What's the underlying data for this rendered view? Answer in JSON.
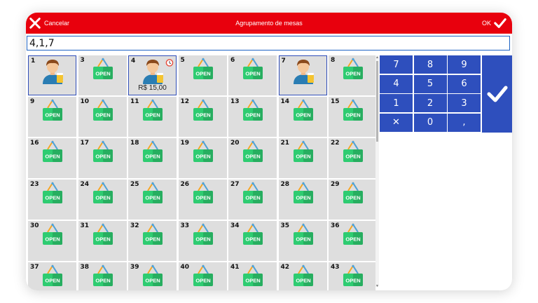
{
  "header": {
    "cancel_label": "Cancelar",
    "title": "Agrupamento de mesas",
    "ok_label": "OK",
    "bg_color": "#e8000d"
  },
  "input": {
    "value": "4,1,7"
  },
  "open_label": "OPEN",
  "tables": [
    {
      "number": "1",
      "state": "occupied",
      "selected": true
    },
    {
      "number": "3",
      "state": "open"
    },
    {
      "number": "4",
      "state": "occupied",
      "selected": true,
      "price": "R$ 15,00",
      "timer": true
    },
    {
      "number": "5",
      "state": "open"
    },
    {
      "number": "6",
      "state": "open"
    },
    {
      "number": "7",
      "state": "occupied",
      "selected": true
    },
    {
      "number": "8",
      "state": "open"
    },
    {
      "number": "9",
      "state": "open"
    },
    {
      "number": "10",
      "state": "open"
    },
    {
      "number": "11",
      "state": "open"
    },
    {
      "number": "12",
      "state": "open"
    },
    {
      "number": "13",
      "state": "open"
    },
    {
      "number": "14",
      "state": "open"
    },
    {
      "number": "15",
      "state": "open"
    },
    {
      "number": "16",
      "state": "open"
    },
    {
      "number": "17",
      "state": "open"
    },
    {
      "number": "18",
      "state": "open"
    },
    {
      "number": "19",
      "state": "open"
    },
    {
      "number": "20",
      "state": "open"
    },
    {
      "number": "21",
      "state": "open"
    },
    {
      "number": "22",
      "state": "open"
    },
    {
      "number": "23",
      "state": "open"
    },
    {
      "number": "24",
      "state": "open"
    },
    {
      "number": "25",
      "state": "open"
    },
    {
      "number": "26",
      "state": "open"
    },
    {
      "number": "27",
      "state": "open"
    },
    {
      "number": "28",
      "state": "open"
    },
    {
      "number": "29",
      "state": "open"
    },
    {
      "number": "30",
      "state": "open"
    },
    {
      "number": "31",
      "state": "open"
    },
    {
      "number": "32",
      "state": "open"
    },
    {
      "number": "33",
      "state": "open"
    },
    {
      "number": "34",
      "state": "open"
    },
    {
      "number": "35",
      "state": "open"
    },
    {
      "number": "36",
      "state": "open"
    },
    {
      "number": "37",
      "state": "open"
    },
    {
      "number": "38",
      "state": "open"
    },
    {
      "number": "39",
      "state": "open"
    },
    {
      "number": "40",
      "state": "open"
    },
    {
      "number": "41",
      "state": "open"
    },
    {
      "number": "42",
      "state": "open"
    },
    {
      "number": "43",
      "state": "open"
    }
  ],
  "keypad": {
    "keys": [
      "7",
      "8",
      "9",
      "4",
      "5",
      "6",
      "1",
      "2",
      "3",
      "✕",
      "0",
      ","
    ],
    "enter_icon": "check-icon",
    "color": "#2e4fbd"
  },
  "colors": {
    "selected_border": "#2f4db8",
    "open_sign": "#2ecc71",
    "cell_bg": "#dedede"
  }
}
